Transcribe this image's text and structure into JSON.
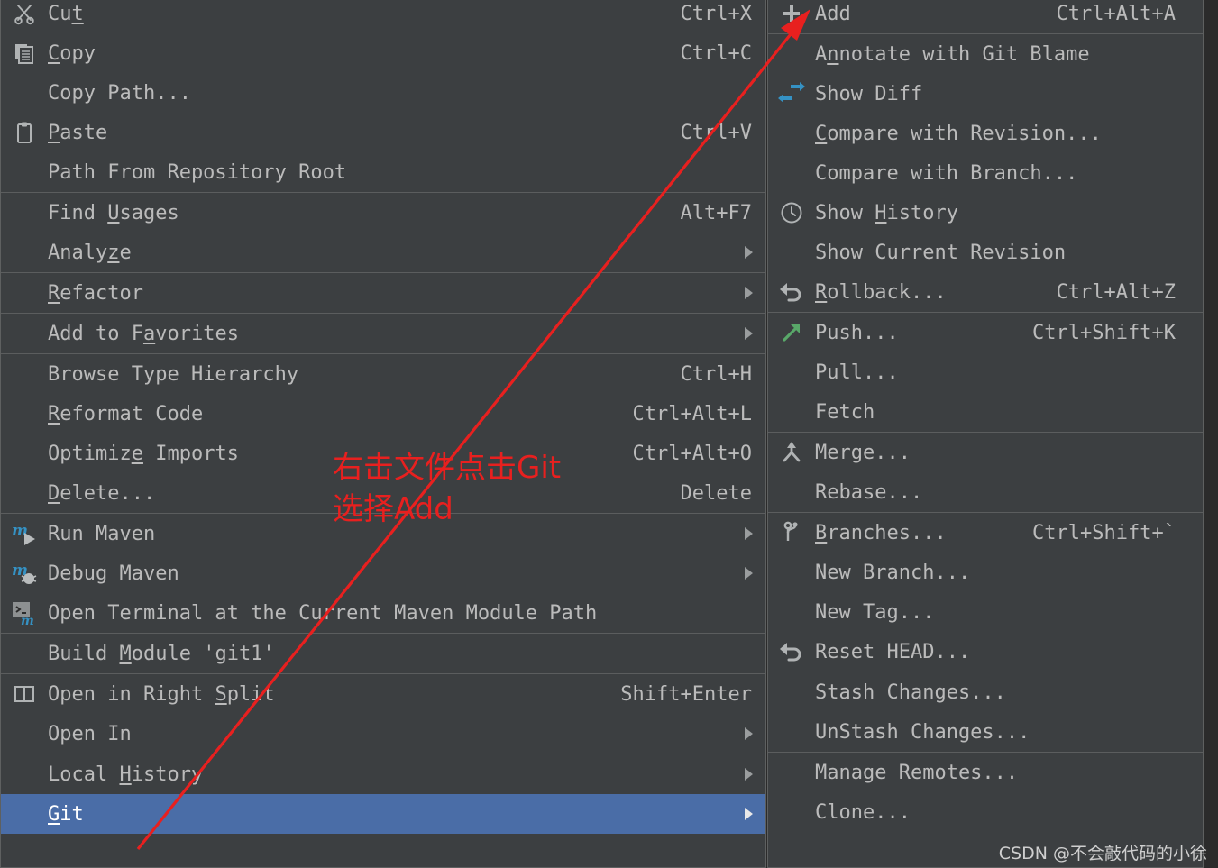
{
  "main_menu": {
    "groups": [
      {
        "items": [
          {
            "icon": "scissors-icon",
            "label": "Cut",
            "mnemonic_index": 2,
            "shortcut": "Ctrl+X",
            "submenu": false
          },
          {
            "icon": "copy-icon",
            "label": "Copy",
            "mnemonic_index": 0,
            "shortcut": "Ctrl+C",
            "submenu": false
          },
          {
            "icon": null,
            "label": "Copy Path...",
            "mnemonic_index": -1,
            "shortcut": "",
            "submenu": false
          },
          {
            "icon": "clipboard-icon",
            "label": "Paste",
            "mnemonic_index": 0,
            "shortcut": "Ctrl+V",
            "submenu": false
          },
          {
            "icon": null,
            "label": "Path From Repository Root",
            "mnemonic_index": -1,
            "shortcut": "",
            "submenu": false
          }
        ]
      },
      {
        "items": [
          {
            "icon": null,
            "label": "Find Usages",
            "mnemonic_index": 5,
            "shortcut": "Alt+F7",
            "submenu": false
          },
          {
            "icon": null,
            "label": "Analyze",
            "mnemonic_index": 5,
            "shortcut": "",
            "submenu": true
          }
        ]
      },
      {
        "items": [
          {
            "icon": null,
            "label": "Refactor",
            "mnemonic_index": 0,
            "shortcut": "",
            "submenu": true
          }
        ]
      },
      {
        "items": [
          {
            "icon": null,
            "label": "Add to Favorites",
            "mnemonic_index": 8,
            "shortcut": "",
            "submenu": true
          }
        ]
      },
      {
        "items": [
          {
            "icon": null,
            "label": "Browse Type Hierarchy",
            "mnemonic_index": -1,
            "shortcut": "Ctrl+H",
            "submenu": false
          },
          {
            "icon": null,
            "label": "Reformat Code",
            "mnemonic_index": 0,
            "shortcut": "Ctrl+Alt+L",
            "submenu": false
          },
          {
            "icon": null,
            "label": "Optimize Imports",
            "mnemonic_index": 7,
            "shortcut": "Ctrl+Alt+O",
            "submenu": false
          },
          {
            "icon": null,
            "label": "Delete...",
            "mnemonic_index": 0,
            "shortcut": "Delete",
            "submenu": false
          }
        ]
      },
      {
        "items": [
          {
            "icon": "maven-run-icon",
            "label": "Run Maven",
            "mnemonic_index": -1,
            "shortcut": "",
            "submenu": true
          },
          {
            "icon": "maven-debug-icon",
            "label": "Debug Maven",
            "mnemonic_index": -1,
            "shortcut": "",
            "submenu": true
          },
          {
            "icon": "maven-terminal-icon",
            "label": "Open Terminal at the Current Maven Module Path",
            "mnemonic_index": -1,
            "shortcut": "",
            "submenu": false
          }
        ]
      },
      {
        "items": [
          {
            "icon": null,
            "label": "Build Module 'git1'",
            "mnemonic_index": 6,
            "shortcut": "",
            "submenu": false
          }
        ]
      },
      {
        "items": [
          {
            "icon": "split-pane-icon",
            "label": "Open in Right Split",
            "mnemonic_index": 14,
            "shortcut": "Shift+Enter",
            "submenu": false
          },
          {
            "icon": null,
            "label": "Open In",
            "mnemonic_index": -1,
            "shortcut": "",
            "submenu": true
          }
        ]
      },
      {
        "items": [
          {
            "icon": null,
            "label": "Local History",
            "mnemonic_index": 6,
            "shortcut": "",
            "submenu": true
          },
          {
            "icon": null,
            "label": "Git",
            "mnemonic_index": 0,
            "shortcut": "",
            "submenu": true,
            "selected": true
          }
        ]
      }
    ]
  },
  "git_menu": {
    "groups": [
      {
        "items": [
          {
            "icon": "plus-icon",
            "label": "Add",
            "mnemonic_index": -1,
            "shortcut": "Ctrl+Alt+A",
            "submenu": false
          }
        ]
      },
      {
        "items": [
          {
            "icon": null,
            "label": "Annotate with Git Blame",
            "mnemonic_index": 1,
            "shortcut": "",
            "submenu": false
          },
          {
            "icon": "show-diff-icon",
            "label": "Show Diff",
            "mnemonic_index": -1,
            "shortcut": "",
            "submenu": false
          },
          {
            "icon": null,
            "label": "Compare with Revision...",
            "mnemonic_index": 0,
            "shortcut": "",
            "submenu": false
          },
          {
            "icon": null,
            "label": "Compare with Branch...",
            "mnemonic_index": -1,
            "shortcut": "",
            "submenu": false
          },
          {
            "icon": "clock-icon",
            "label": "Show History",
            "mnemonic_index": 5,
            "shortcut": "",
            "submenu": false
          },
          {
            "icon": null,
            "label": "Show Current Revision",
            "mnemonic_index": -1,
            "shortcut": "",
            "submenu": false
          },
          {
            "icon": "rollback-icon",
            "label": "Rollback...",
            "mnemonic_index": 0,
            "shortcut": "Ctrl+Alt+Z",
            "submenu": false
          }
        ]
      },
      {
        "items": [
          {
            "icon": "push-icon",
            "label": "Push...",
            "mnemonic_index": -1,
            "shortcut": "Ctrl+Shift+K",
            "submenu": false
          },
          {
            "icon": null,
            "label": "Pull...",
            "mnemonic_index": -1,
            "shortcut": "",
            "submenu": false
          },
          {
            "icon": null,
            "label": "Fetch",
            "mnemonic_index": -1,
            "shortcut": "",
            "submenu": false
          }
        ]
      },
      {
        "items": [
          {
            "icon": "merge-icon",
            "label": "Merge...",
            "mnemonic_index": -1,
            "shortcut": "",
            "submenu": false
          },
          {
            "icon": null,
            "label": "Rebase...",
            "mnemonic_index": -1,
            "shortcut": "",
            "submenu": false
          }
        ]
      },
      {
        "items": [
          {
            "icon": "branch-icon",
            "label": "Branches...",
            "mnemonic_index": 0,
            "shortcut": "Ctrl+Shift+`",
            "submenu": false
          },
          {
            "icon": null,
            "label": "New Branch...",
            "mnemonic_index": -1,
            "shortcut": "",
            "submenu": false
          },
          {
            "icon": null,
            "label": "New Tag...",
            "mnemonic_index": -1,
            "shortcut": "",
            "submenu": false
          },
          {
            "icon": "reset-head-icon",
            "label": "Reset HEAD...",
            "mnemonic_index": -1,
            "shortcut": "",
            "submenu": false
          }
        ]
      },
      {
        "items": [
          {
            "icon": null,
            "label": "Stash Changes...",
            "mnemonic_index": -1,
            "shortcut": "",
            "submenu": false
          },
          {
            "icon": null,
            "label": "UnStash Changes...",
            "mnemonic_index": -1,
            "shortcut": "",
            "submenu": false
          }
        ]
      },
      {
        "items": [
          {
            "icon": null,
            "label": "Manage Remotes...",
            "mnemonic_index": -1,
            "shortcut": "",
            "submenu": false
          },
          {
            "icon": null,
            "label": "Clone...",
            "mnemonic_index": -1,
            "shortcut": "",
            "submenu": false
          }
        ]
      }
    ]
  },
  "annotation": {
    "line1": "右击文件点击Git",
    "line2": "选择Add",
    "color": "#e8201f"
  },
  "watermark": {
    "text": "CSDN @不会敲代码的小徐"
  },
  "colors": {
    "menu_background": "#3c3f41",
    "menu_border": "#5e6060",
    "separator": "#5b5d5e",
    "text": "#bbbbbb",
    "selection": "#4a6da7",
    "desktop": "#2b2b2b",
    "accent_blue": "#3592c4",
    "accent_green": "#59a869"
  }
}
